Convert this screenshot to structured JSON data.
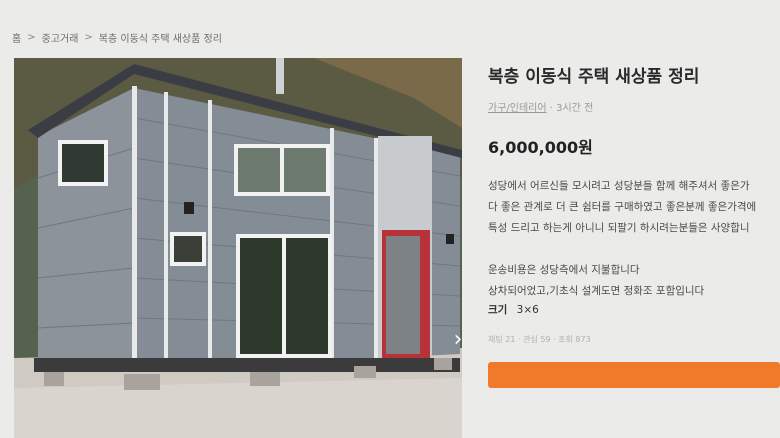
{
  "breadcrumb": {
    "items": [
      "홈",
      "중고거래",
      "복층 이동식 주택 새상품 정리"
    ]
  },
  "listing": {
    "title": "복층 이동식 주택 새상품 정리",
    "category": "가구/인테리어",
    "time_ago": "3시간 전",
    "price": "6,000,000원",
    "description": [
      "성당에서 어르신들 모시려고 성당분들 함께 해주셔서 좋은가",
      "다 좋은 관계로 더 큰 쉼터를 구매하였고 좋은분께 좋은가격에",
      "특성 드리고 하는게 아니니 되팔기 하시려는분들은 사양합니",
      "",
      "운송비용은 성당측에서 지불합니다",
      "상차되어었고,기초식 설계도면 정화조 포함입니다"
    ],
    "spec_label": "크기",
    "spec_value": "3×6",
    "stats": "채팅 21 · 관심 59 · 조회 873"
  },
  "icons": {
    "next": "chevron-right-icon"
  },
  "colors": {
    "accent": "#f07a2a",
    "background": "#ebebe9"
  }
}
